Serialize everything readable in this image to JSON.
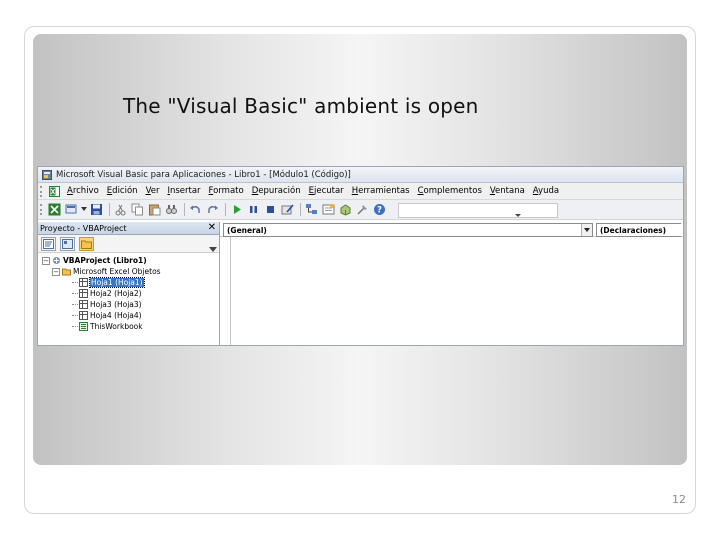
{
  "slide": {
    "title": "The \"Visual Basic\" ambient is open",
    "page_number": "12"
  },
  "vbe": {
    "window_title": "Microsoft Visual Basic para Aplicaciones - Libro1 - [Módulo1 (Código)]",
    "menu": [
      "Archivo",
      "Edición",
      "Ver",
      "Insertar",
      "Formato",
      "Depuración",
      "Ejecutar",
      "Herramientas",
      "Complementos",
      "Ventana",
      "Ayuda"
    ],
    "toolbar_icons": [
      "excel-view-icon",
      "insert-module-icon",
      "save-icon",
      "cut-icon",
      "copy-icon",
      "paste-icon",
      "find-icon",
      "undo-icon",
      "redo-icon",
      "run-icon",
      "break-icon",
      "reset-icon",
      "design-mode-icon",
      "project-explorer-icon",
      "properties-icon",
      "object-browser-icon",
      "toolbox-icon",
      "help-icon"
    ],
    "project_pane": {
      "title": "Proyecto - VBAProject",
      "close": "✕",
      "tree": [
        {
          "label": "VBAProject (Libro1)",
          "level": 0,
          "toggle": "−",
          "icon": "vba-project-icon",
          "bold": true
        },
        {
          "label": "Microsoft Excel Objetos",
          "level": 1,
          "toggle": "−",
          "icon": "folder-icon"
        },
        {
          "label": "Hoja1 (Hoja1)",
          "level": 2,
          "icon": "sheet-icon",
          "selected": true
        },
        {
          "label": "Hoja2 (Hoja2)",
          "level": 2,
          "icon": "sheet-icon"
        },
        {
          "label": "Hoja3 (Hoja3)",
          "level": 2,
          "icon": "sheet-icon"
        },
        {
          "label": "Hoja4 (Hoja4)",
          "level": 2,
          "icon": "sheet-icon"
        },
        {
          "label": "ThisWorkbook",
          "level": 2,
          "icon": "workbook-icon"
        }
      ]
    },
    "code": {
      "object_selector": "(General)",
      "procedure_selector": "(Declaraciones)"
    }
  }
}
